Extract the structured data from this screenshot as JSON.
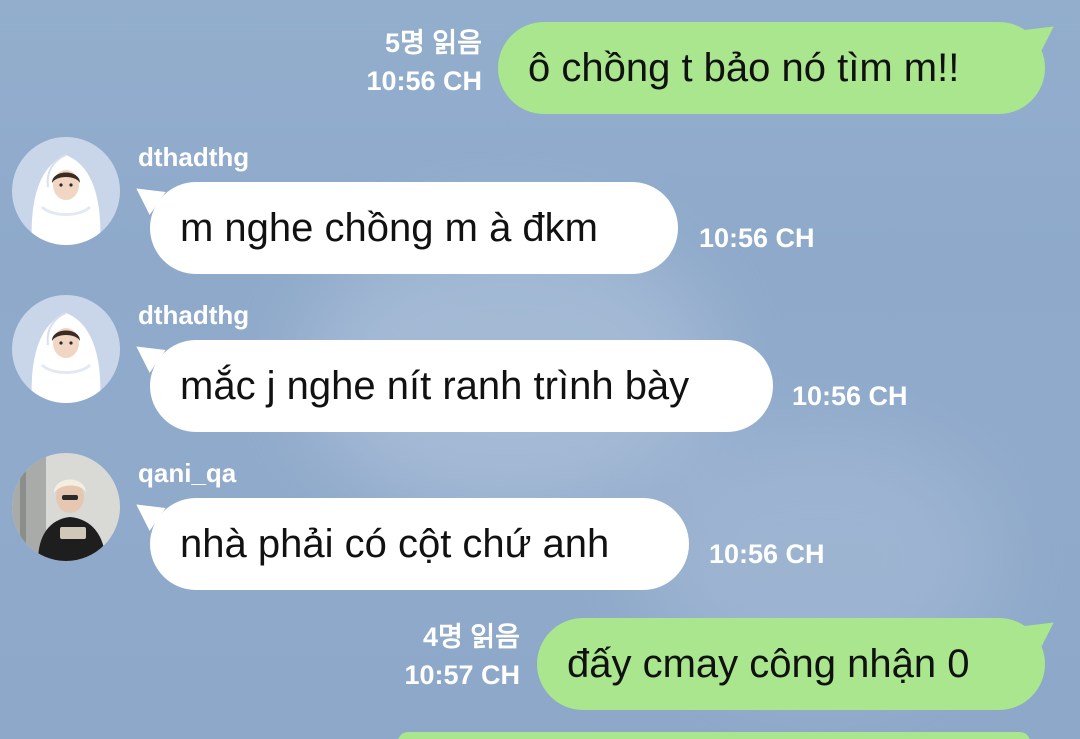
{
  "messages": [
    {
      "direction": "outgoing",
      "text": "ô chồng t bảo nó tìm m!!",
      "read_count": "5명 읽음",
      "time": "10:56 CH"
    },
    {
      "direction": "incoming",
      "sender": "dthadthg",
      "text": "m nghe chồng m à đkm",
      "time": "10:56 CH",
      "avatar": "girl-in-white-blanket"
    },
    {
      "direction": "incoming",
      "sender": "dthadthg",
      "text": "mắc j nghe nít ranh trình bày",
      "time": "10:56 CH",
      "avatar": "girl-in-white-blanket"
    },
    {
      "direction": "incoming",
      "sender": "qani_qa",
      "text": "nhà phải có cột chứ anh",
      "time": "10:56 CH",
      "avatar": "man-in-black-sweater"
    },
    {
      "direction": "outgoing",
      "text": "đấy cmay công nhận 0",
      "read_count": "4명 읽음",
      "time": "10:57 CH"
    }
  ],
  "colors": {
    "background": "#90aacb",
    "outgoing_bubble": "#a9e68d",
    "incoming_bubble": "#ffffff",
    "meta_text": "#ffffff"
  }
}
